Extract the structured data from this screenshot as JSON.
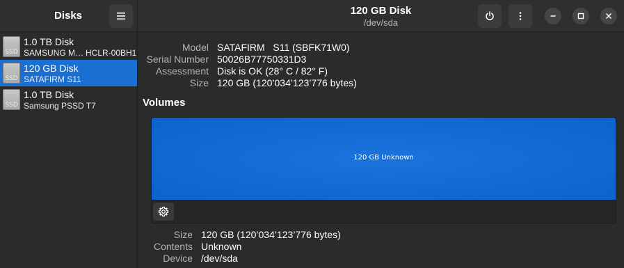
{
  "app": {
    "title": "Disks",
    "menu_icon": "hamburger-icon"
  },
  "header": {
    "title": "120 GB Disk",
    "subtitle": "/dev/sda"
  },
  "sidebar": {
    "disks": [
      {
        "name": "1.0 TB Disk",
        "model": "SAMSUNG M…",
        "model_suffix": "HCLR-00BH1",
        "icon_label": "SSD",
        "selected": false
      },
      {
        "name": "120 GB Disk",
        "model": "SATAFIRM   S11",
        "model_suffix": "",
        "icon_label": "SSD",
        "selected": true
      },
      {
        "name": "1.0 TB Disk",
        "model": "Samsung PSSD T7",
        "model_suffix": "",
        "icon_label": "SSD",
        "selected": false
      }
    ]
  },
  "details": {
    "model_label": "Model",
    "model_value": "SATAFIRM   S11 (SBFK71W0)",
    "serial_label": "Serial Number",
    "serial_value": "50026B77750331D3",
    "assessment_label": "Assessment",
    "assessment_value": "Disk is OK (28° C / 82° F)",
    "size_label": "Size",
    "size_value": "120 GB (120’034’123’776 bytes)"
  },
  "volumes": {
    "heading": "Volumes",
    "block_label": "120 GB Unknown",
    "size_label": "Size",
    "size_value": "120 GB (120’034’123’776 bytes)",
    "contents_label": "Contents",
    "contents_value": "Unknown",
    "device_label": "Device",
    "device_value": "/dev/sda"
  },
  "colors": {
    "accent": "#1b6fd1",
    "volume_blue": "#0b63cc",
    "background": "#2b2b2b",
    "header": "#2f2f2f"
  }
}
